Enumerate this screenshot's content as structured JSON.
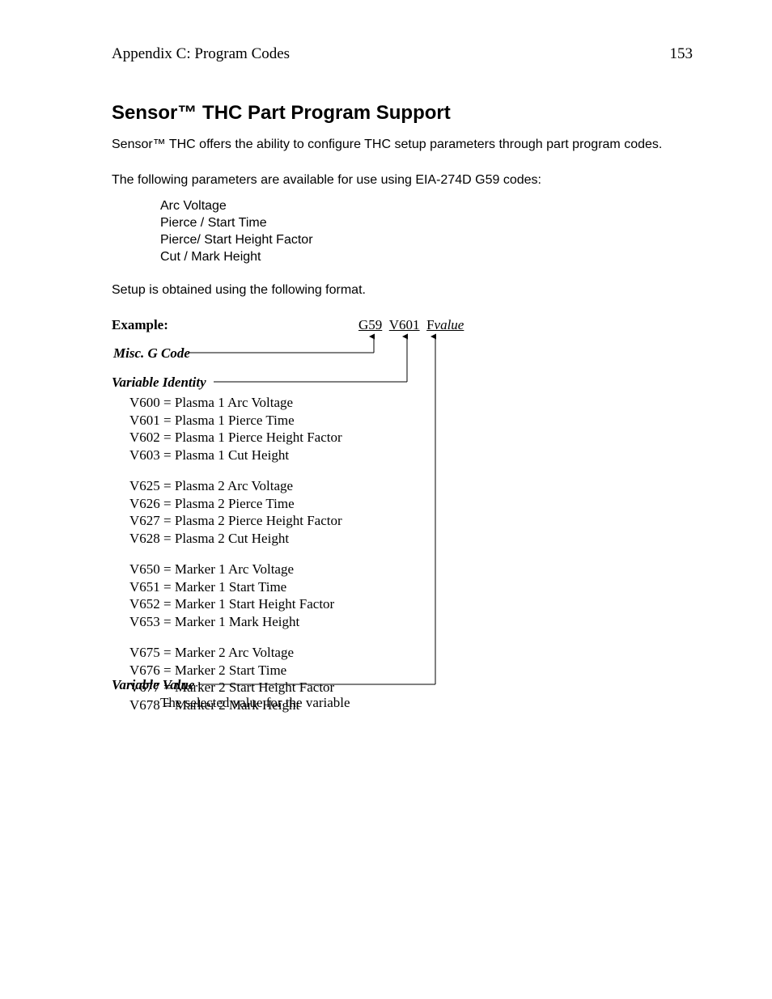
{
  "header": {
    "left": "Appendix C: Program Codes",
    "pageNumber": "153"
  },
  "title": "Sensor™ THC Part Program Support",
  "para1": "Sensor™ THC offers the ability to configure THC setup parameters through part program codes.",
  "para2": "The following parameters are available for use using EIA-274D G59 codes:",
  "paramList": [
    "Arc Voltage",
    "Pierce / Start Time",
    "Pierce/ Start Height Factor",
    "Cut / Mark Height"
  ],
  "para3": "Setup is obtained using the following format.",
  "example": {
    "label": "Example:",
    "code": {
      "g": "G59",
      "v": "V601",
      "fPrefix": "F",
      "fVal": "value"
    },
    "miscLabel": "Misc. G Code",
    "varIdentityLabel": "Variable Identity",
    "varGroups": [
      [
        "V600 = Plasma 1 Arc Voltage",
        "V601 = Plasma 1 Pierce Time",
        "V602 = Plasma 1 Pierce Height Factor",
        "V603 = Plasma 1 Cut Height"
      ],
      [
        "V625 = Plasma 2 Arc Voltage",
        "V626 = Plasma 2 Pierce Time",
        "V627 = Plasma 2 Pierce Height Factor",
        "V628 = Plasma 2 Cut Height"
      ],
      [
        "V650 = Marker 1 Arc Voltage",
        "V651 = Marker 1 Start Time",
        "V652 = Marker 1 Start Height Factor",
        "V653 = Marker 1 Mark Height"
      ],
      [
        "V675 = Marker 2 Arc Voltage",
        "V676 = Marker 2 Start Time",
        "V677 = Marker 2 Start Height Factor",
        "V678 = Marker 2 Mark Height"
      ]
    ],
    "varValueLabel": "Variable Value",
    "varValueDesc": "The selected value for the variable"
  }
}
